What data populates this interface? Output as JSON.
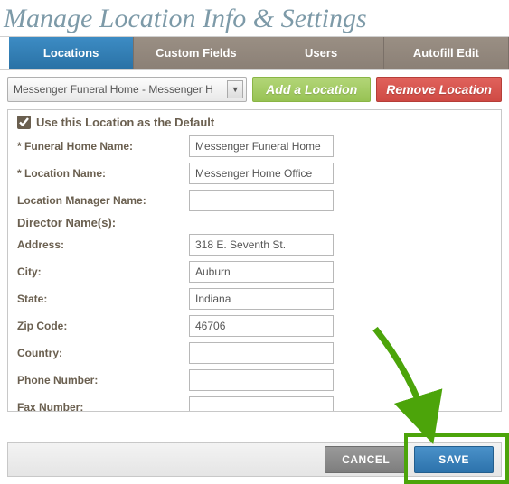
{
  "title": "Manage Location Info & Settings",
  "tabs": {
    "locations": "Locations",
    "custom_fields": "Custom Fields",
    "users": "Users",
    "autofill_edit": "Autofill Edit"
  },
  "controls": {
    "location_select_value": "Messenger Funeral Home - Messenger H",
    "add_location": "Add a Location",
    "remove_location": "Remove Location"
  },
  "form": {
    "default_checkbox_label": "Use this Location as the Default",
    "default_checked": true,
    "fields": {
      "funeral_home_name": {
        "label": "* Funeral Home Name:",
        "value": "Messenger Funeral Home"
      },
      "location_name": {
        "label": "* Location Name:",
        "value": "Messenger Home Office"
      },
      "location_manager_name": {
        "label": "Location Manager Name:",
        "value": ""
      },
      "director_names_header": "Director Name(s):",
      "address": {
        "label": "Address:",
        "value": "318 E. Seventh St."
      },
      "city": {
        "label": "City:",
        "value": "Auburn"
      },
      "state": {
        "label": "State:",
        "value": "Indiana"
      },
      "zip": {
        "label": "Zip Code:",
        "value": "46706"
      },
      "country": {
        "label": "Country:",
        "value": ""
      },
      "phone": {
        "label": "Phone Number:",
        "value": ""
      },
      "fax": {
        "label": "Fax Number:",
        "value": ""
      }
    }
  },
  "footer": {
    "cancel": "CANCEL",
    "save": "SAVE"
  },
  "annotation": {
    "arrow_color": "#4ca40a"
  }
}
